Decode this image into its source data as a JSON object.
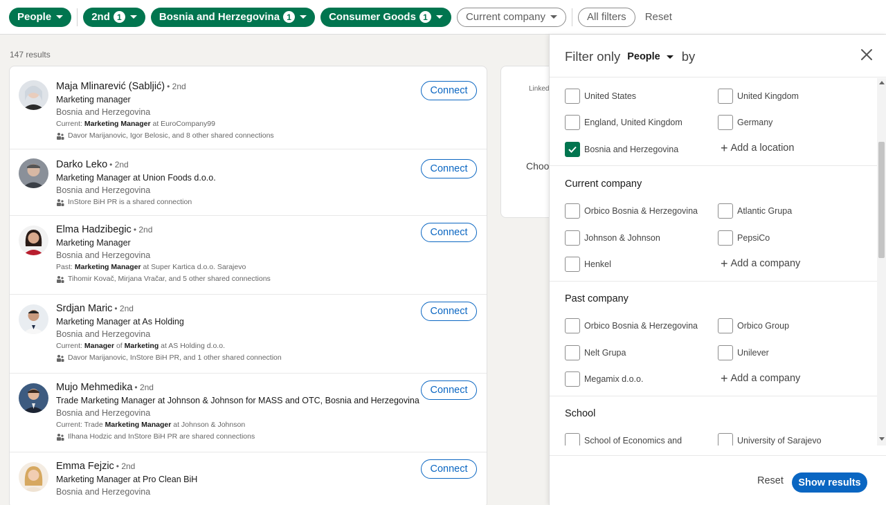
{
  "topbar": {
    "people": "People",
    "connections": "2nd",
    "connections_count": "1",
    "location": "Bosnia and Herzegovina",
    "location_count": "1",
    "industry": "Consumer Goods",
    "industry_count": "1",
    "current_company": "Current company",
    "all_filters": "All filters",
    "reset": "Reset"
  },
  "results_count": "147 results",
  "results": [
    {
      "name": "Maja Mlinarević (Sabljić)",
      "degree": "• 2nd",
      "headline": "Marketing manager",
      "location": "Bosnia and Herzegovina",
      "meta_prefix": "Current:",
      "meta_bold": "Marketing Manager",
      "meta_suffix": "at EuroCompany99",
      "shared": "Davor Marijanovic, Igor Belosic, and 8 other shared connections",
      "connect": "Connect"
    },
    {
      "name": "Darko Leko",
      "degree": "• 2nd",
      "headline": "Marketing Manager at Union Foods d.o.o.",
      "location": "Bosnia and Herzegovina",
      "shared": "InStore BiH PR is a shared connection",
      "connect": "Connect"
    },
    {
      "name": "Elma Hadzibegic",
      "degree": "• 2nd",
      "headline": "Marketing Manager",
      "location": "Bosnia and Herzegovina",
      "meta_prefix": "Past:",
      "meta_bold": "Marketing Manager",
      "meta_suffix": "at Super Kartica d.o.o. Sarajevo",
      "shared": "Tihomir Kovač, Mirjana Vračar, and 5 other shared connections",
      "connect": "Connect"
    },
    {
      "name": "Srdjan Maric",
      "degree": "• 2nd",
      "headline": "Marketing Manager at As Holding",
      "location": "Bosnia and Herzegovina",
      "meta_prefix": "Current:",
      "meta_bold": "Manager",
      "meta_mid": "of",
      "meta_bold2": "Marketing",
      "meta_suffix": "at AS Holding d.o.o.",
      "shared": "Davor Marijanovic, InStore BiH PR, and 1 other shared connection",
      "connect": "Connect"
    },
    {
      "name": "Mujo Mehmedika",
      "degree": "• 2nd",
      "headline": "Trade Marketing Manager at Johnson & Johnson for MASS and OTC, Bosnia and Herzegovina",
      "location": "Bosnia and Herzegovina",
      "meta_prefix": "Current: Trade",
      "meta_bold": "Marketing Manager",
      "meta_suffix": "at Johnson & Johnson",
      "shared": "Ilhana Hodzic and InStore BiH PR are shared connections",
      "connect": "Connect"
    },
    {
      "name": "Emma Fejzic",
      "degree": "• 2nd",
      "headline": "Marketing Manager at Pro Clean BiH",
      "location": "Bosnia and Herzegovina",
      "connect": "Connect"
    }
  ],
  "side_card": {
    "label": "Linked",
    "choose": "Choos"
  },
  "panel": {
    "filter_only": "Filter only",
    "selected": "People",
    "by": "by",
    "locations": [
      "United States",
      "United Kingdom",
      "England, United Kingdom",
      "Germany",
      "Bosnia and Herzegovina"
    ],
    "add_location": "Add a location",
    "current_company_title": "Current company",
    "current_companies": [
      "Orbico Bosnia & Herzegovina",
      "Atlantic Grupa",
      "Johnson & Johnson",
      "PepsiCo",
      "Henkel"
    ],
    "add_company": "Add a company",
    "past_company_title": "Past company",
    "past_companies": [
      "Orbico Bosnia & Herzegovina",
      "Orbico Group",
      "Nelt Grupa",
      "Unilever",
      "Megamix d.o.o."
    ],
    "add_past_company": "Add a company",
    "school_title": "School",
    "schools": [
      "School of Economics and",
      "University of Sarajevo"
    ],
    "reset": "Reset",
    "show_results": "Show results"
  },
  "colors": {
    "green": "#01754f",
    "blue": "#0a66c2"
  }
}
